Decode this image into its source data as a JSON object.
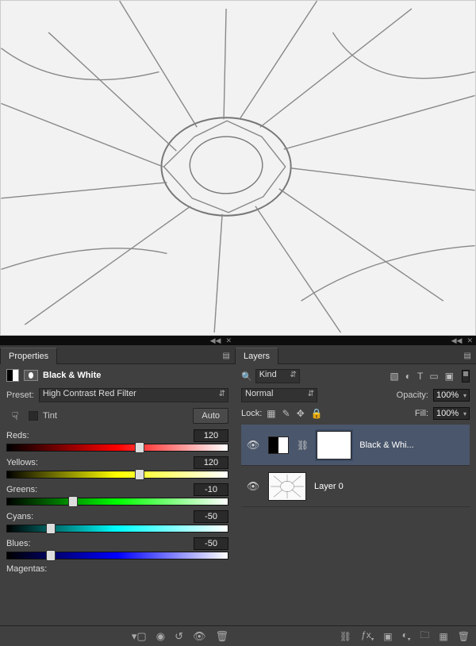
{
  "properties": {
    "tab": "Properties",
    "adjustment_name": "Black & White",
    "preset_label": "Preset:",
    "preset_value": "High Contrast Red Filter",
    "tint_label": "Tint",
    "tint_checked": false,
    "auto_label": "Auto",
    "sliders": [
      {
        "label": "Reds:",
        "value": "120",
        "pos": 60,
        "grad": "grad-red"
      },
      {
        "label": "Yellows:",
        "value": "120",
        "pos": 60,
        "grad": "grad-yellow"
      },
      {
        "label": "Greens:",
        "value": "-10",
        "pos": 30,
        "grad": "grad-green"
      },
      {
        "label": "Cyans:",
        "value": "-50",
        "pos": 20,
        "grad": "grad-cyan"
      },
      {
        "label": "Blues:",
        "value": "-50",
        "pos": 20,
        "grad": "grad-blue"
      }
    ],
    "magentas_label": "Magentas:",
    "footer_icons": [
      "clip-to-layer",
      "view-previous",
      "reset",
      "visibility",
      "trash"
    ]
  },
  "layers": {
    "tab": "Layers",
    "filter_kind": "Kind",
    "filter_icons": [
      "pixel",
      "adjustment",
      "type",
      "shape",
      "smart"
    ],
    "blend_mode": "Normal",
    "opacity_label": "Opacity:",
    "opacity_value": "100%",
    "lock_label": "Lock:",
    "fill_label": "Fill:",
    "fill_value": "100%",
    "items": [
      {
        "name": "Black & Whi...",
        "selected": true,
        "type": "adjustment",
        "visible": true
      },
      {
        "name": "Layer 0",
        "selected": false,
        "type": "pixel",
        "visible": true
      }
    ],
    "footer_icons": [
      "link",
      "fx",
      "mask",
      "adjust",
      "group",
      "new",
      "trash"
    ]
  }
}
